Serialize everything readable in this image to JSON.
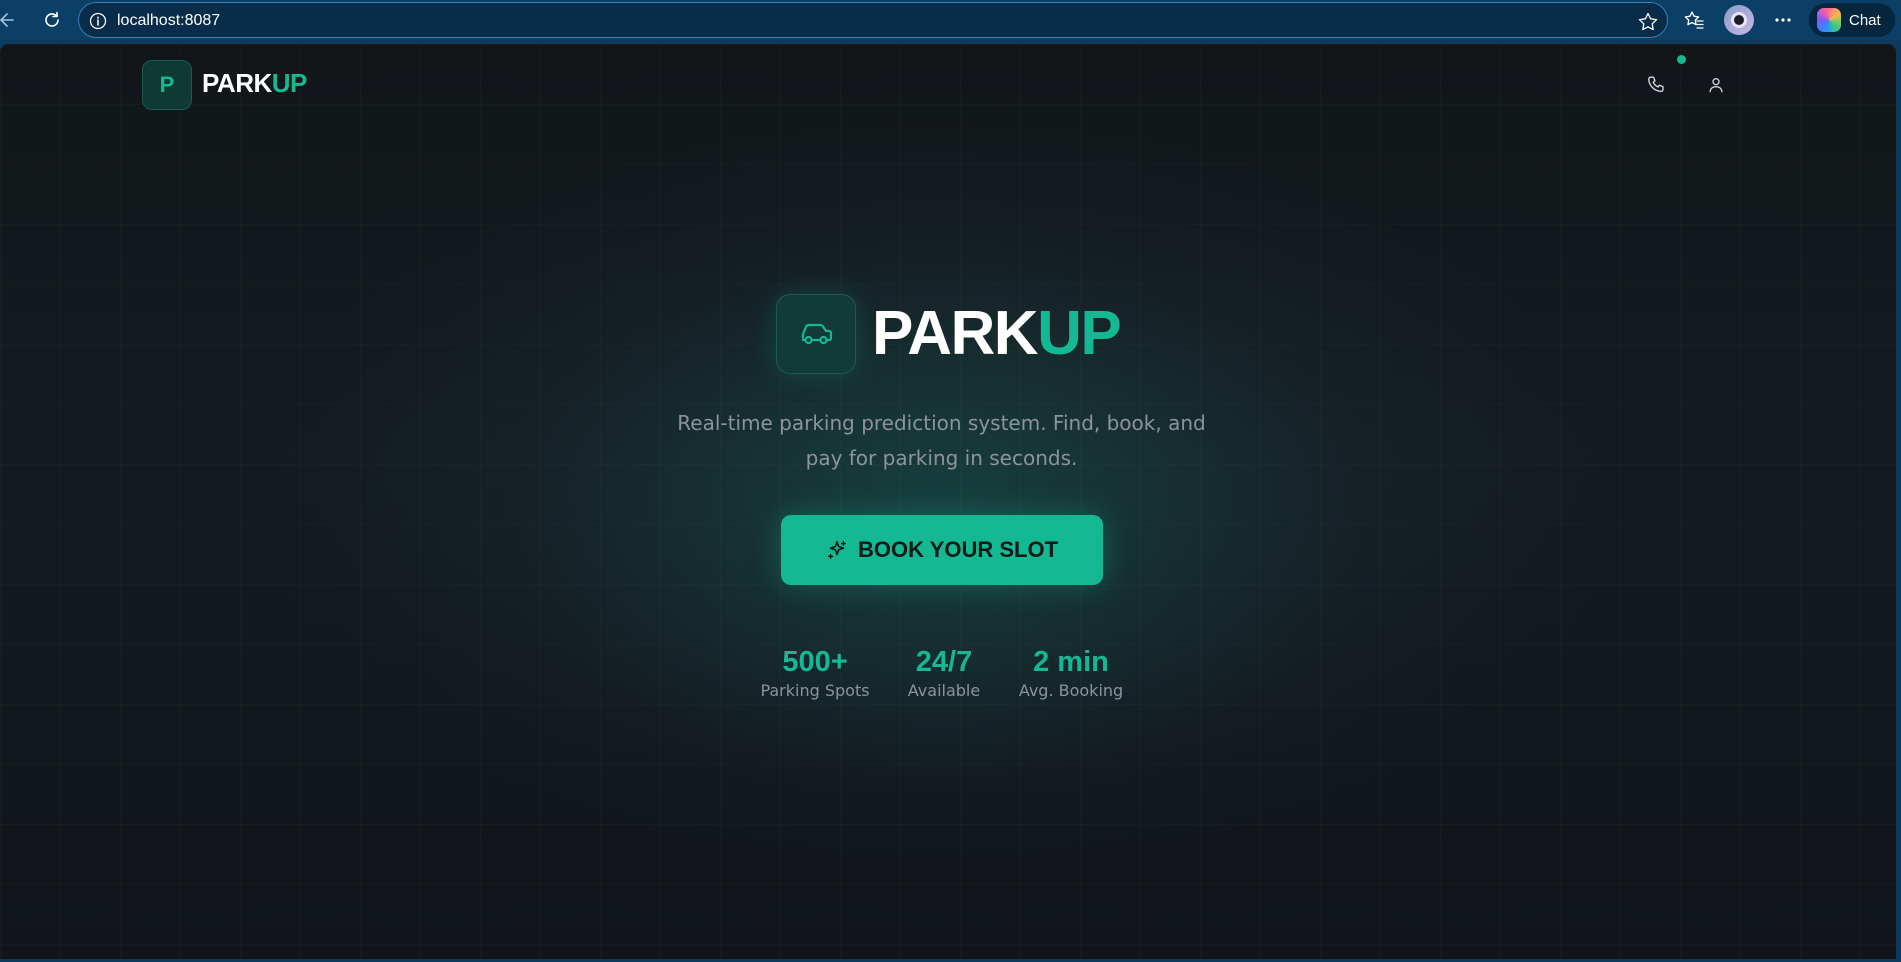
{
  "browser": {
    "url": "localhost:8087",
    "chat_label": "Chat"
  },
  "header": {
    "logo_letter": "P",
    "brand_part1": "PARK",
    "brand_part2": "UP"
  },
  "hero": {
    "title_part1": "PARK",
    "title_part2": "UP",
    "tagline_line1": "Real-time parking prediction system. Find, book, and",
    "tagline_line2": "pay for parking in seconds.",
    "cta_label": "BOOK YOUR SLOT"
  },
  "stats": [
    {
      "value": "500+",
      "label": "Parking Spots"
    },
    {
      "value": "24/7",
      "label": "Available"
    },
    {
      "value": "2 min",
      "label": "Avg. Booking"
    }
  ],
  "colors": {
    "accent": "#14b892",
    "background": "#121619",
    "muted_text": "#8b949c",
    "browser_chrome": "#0b3f66"
  },
  "icons": {
    "back": "arrow-left-icon",
    "refresh": "refresh-icon",
    "site_info": "info-icon",
    "favorite": "star-icon",
    "favorites": "favorites-icon",
    "more": "more-icon",
    "copilot": "copilot-icon",
    "phone": "phone-icon",
    "user": "user-icon",
    "car": "car-icon",
    "sparkle": "sparkle-icon"
  }
}
